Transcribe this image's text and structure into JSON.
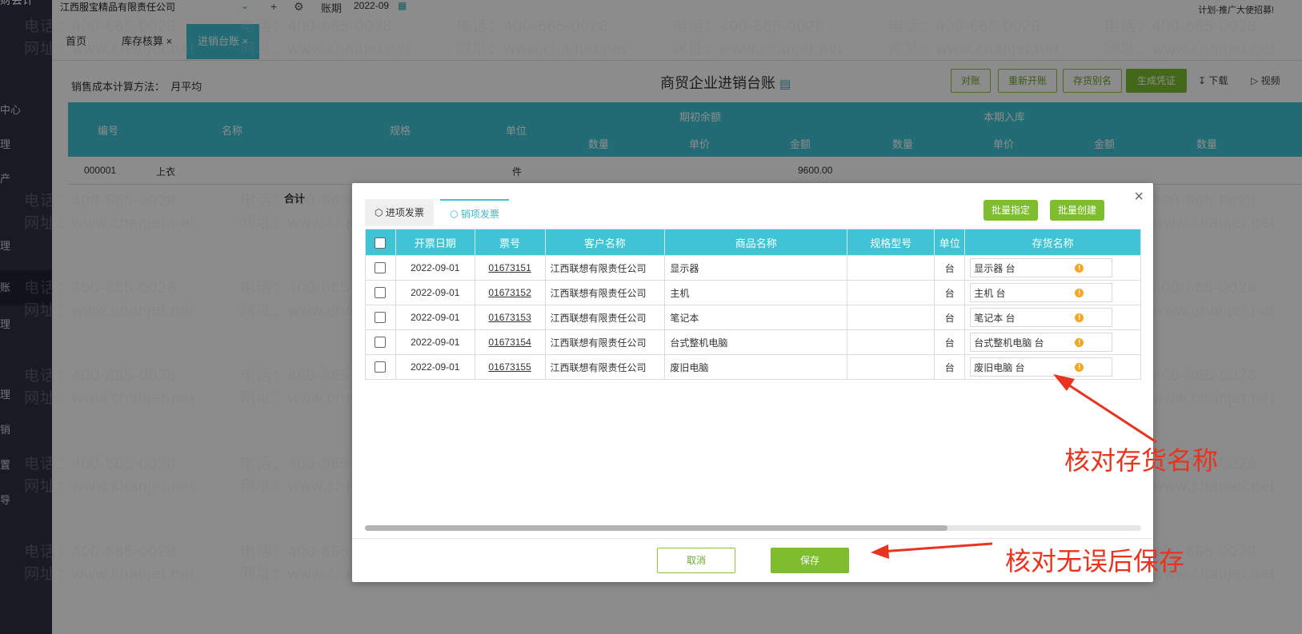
{
  "sidebar": {
    "logo": "财会计",
    "items": [
      "中心",
      "理",
      "产",
      "理",
      "账",
      "理",
      "理",
      "销",
      "置",
      "导"
    ]
  },
  "topbar": {
    "company": "江西服宝精品有限责任公司",
    "period_label": "账期",
    "period_value": "2022-09",
    "promo": "计划-推广大使招募!"
  },
  "tabs": [
    "首页",
    "库存核算",
    "进销台账"
  ],
  "page": {
    "method_label": "销售成本计算方法：",
    "method_value": "月平均",
    "title": "商贸企业进销台账",
    "buttons": [
      "对账",
      "重新开账",
      "存货别名",
      "生成凭证"
    ],
    "download": "下载",
    "video": "视频"
  },
  "ledger": {
    "headers_top": [
      "编号",
      "名称",
      "规格",
      "单位",
      "期初余额",
      "本期入库"
    ],
    "headers_sub": [
      "数量",
      "单价",
      "金额",
      "数量",
      "单价",
      "金额",
      "数量"
    ],
    "row": {
      "code": "000001",
      "name": "上衣",
      "unit": "件",
      "amount": "9600.00"
    },
    "total": "合计"
  },
  "watermark": {
    "phone": "电话：400-665-0028",
    "site": "网址：www.chanjet.net"
  },
  "modal": {
    "tab_purchase": "进项发票",
    "tab_sales": "销项发票",
    "btn_batch_assign": "批量指定",
    "btn_batch_create": "批量创建",
    "close": "×",
    "columns": [
      "开票日期",
      "票号",
      "客户名称",
      "商品名称",
      "规格型号",
      "单位",
      "存货名称"
    ],
    "rows": [
      {
        "date": "2022-09-01",
        "invoice": "01673151",
        "customer": "江西联想有限责任公司",
        "product": "显示器",
        "spec": "",
        "unit": "台",
        "stock": "显示器 台"
      },
      {
        "date": "2022-09-01",
        "invoice": "01673152",
        "customer": "江西联想有限责任公司",
        "product": "主机",
        "spec": "",
        "unit": "台",
        "stock": "主机 台"
      },
      {
        "date": "2022-09-01",
        "invoice": "01673153",
        "customer": "江西联想有限责任公司",
        "product": "笔记本",
        "spec": "",
        "unit": "台",
        "stock": "笔记本 台"
      },
      {
        "date": "2022-09-01",
        "invoice": "01673154",
        "customer": "江西联想有限责任公司",
        "product": "台式整机电脑",
        "spec": "",
        "unit": "台",
        "stock": "台式整机电脑 台"
      },
      {
        "date": "2022-09-01",
        "invoice": "01673155",
        "customer": "江西联想有限责任公司",
        "product": "废旧电脑",
        "spec": "",
        "unit": "台",
        "stock": "废旧电脑 台"
      }
    ],
    "cancel": "取消",
    "save": "保存",
    "horizontal_scroll_fraction": 0.75
  },
  "annotations": {
    "check_stock": "核对存货名称",
    "save_after_check": "核对无误后保存",
    "color": "#e8331f"
  },
  "colors": {
    "accent": "#3fc4d6",
    "green": "#7dbd2e",
    "warn": "#f5a623"
  }
}
